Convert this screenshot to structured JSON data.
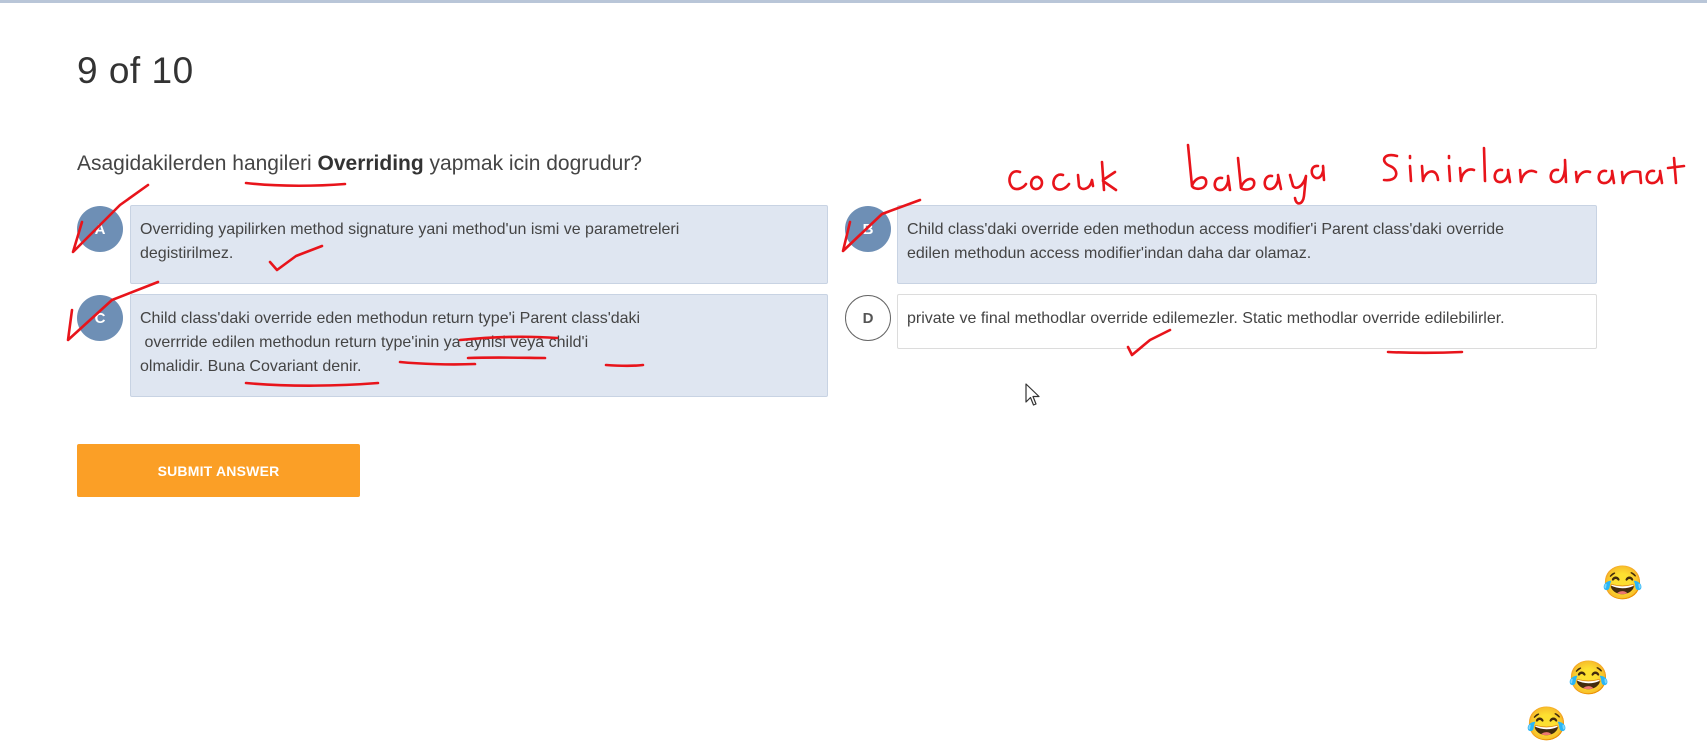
{
  "quiz": {
    "progress": "9 of 10",
    "question": {
      "part1": "Asagidakilerden hangileri ",
      "bold": "Overriding",
      "part2": " yapmak icin dogrudur?"
    },
    "options": [
      {
        "letter": "A",
        "selected": true,
        "lines": [
          "Overriding yapilirken method signature yani method'un ismi ve parametreleri",
          "degistirilmez."
        ]
      },
      {
        "letter": "B",
        "selected": true,
        "lines": [
          "Child class'daki override eden methodun access modifier'i Parent class'daki override",
          "edilen methodun access modifier'indan daha dar olamaz."
        ]
      },
      {
        "letter": "C",
        "selected": true,
        "lines": [
          "Child class'daki override eden methodun return type'i Parent class'daki",
          " overrride edilen methodun return type'inin ya aynisi veya child'i",
          "olmalidir. Buna Covariant denir."
        ]
      },
      {
        "letter": "D",
        "selected": false,
        "lines": [
          "private ve final methodlar override edilemezler. Static methodlar override edilebilirler."
        ]
      }
    ],
    "submit_label": "SUBMIT ANSWER"
  },
  "colors": {
    "accent_orange": "#fb9f26",
    "selected_badge": "#6e8fb5",
    "selected_box": "#dfe6f1",
    "annotation_ink": "#e8141b"
  },
  "annotations": {
    "handwriting": [
      "cocuk",
      "babaya",
      "sinirlari daraltamaz"
    ],
    "marks": "check marks and underlines drawn in red ink"
  },
  "floating_reactions": [
    "laughing-tears-emoji",
    "laughing-tears-emoji",
    "laughing-tears-emoji"
  ]
}
